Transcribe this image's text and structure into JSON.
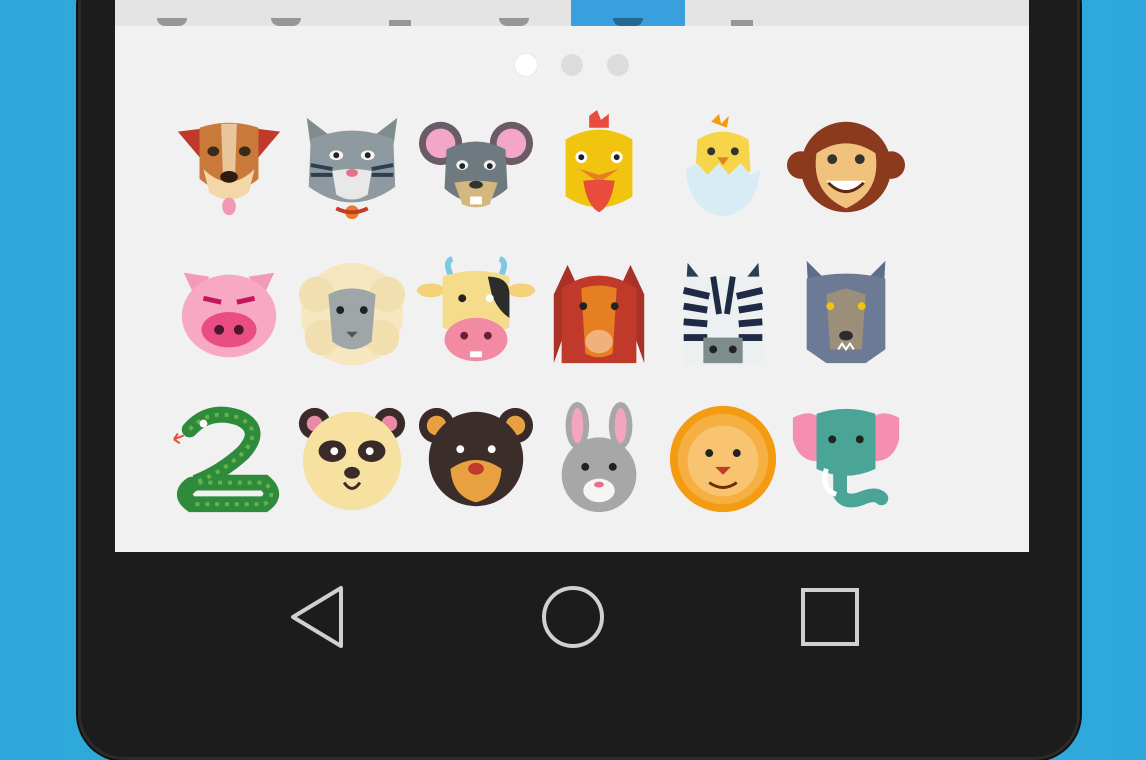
{
  "colors": {
    "background": "#33aee0",
    "phone_body": "#1c1c1c",
    "screen": "#f1f1f1",
    "tab_active": "#3aa0dd",
    "nav_icon": "#d0d0d0"
  },
  "tabs": [
    {
      "icon": "recent-icon",
      "active": false
    },
    {
      "icon": "emoji-icon",
      "active": false
    },
    {
      "icon": "object-icon",
      "active": false
    },
    {
      "icon": "nature-icon",
      "active": false
    },
    {
      "icon": "animals-icon",
      "active": true
    },
    {
      "icon": "symbols-icon",
      "active": false
    },
    {
      "icon": "misc-icon",
      "active": false
    },
    {
      "icon": "more-icon",
      "active": false
    }
  ],
  "pagination": {
    "pages": 3,
    "current": 1
  },
  "stickers": [
    {
      "name": "dog"
    },
    {
      "name": "cat"
    },
    {
      "name": "mouse"
    },
    {
      "name": "rooster"
    },
    {
      "name": "chick"
    },
    {
      "name": "monkey"
    },
    {
      "name": "pig"
    },
    {
      "name": "sheep"
    },
    {
      "name": "cow"
    },
    {
      "name": "horse"
    },
    {
      "name": "zebra"
    },
    {
      "name": "wolf"
    },
    {
      "name": "snake"
    },
    {
      "name": "panda"
    },
    {
      "name": "bear"
    },
    {
      "name": "rabbit"
    },
    {
      "name": "lion"
    },
    {
      "name": "elephant"
    }
  ],
  "nav": {
    "back_icon": "back-triangle-icon",
    "home_icon": "home-circle-icon",
    "recents_icon": "recents-square-icon"
  }
}
